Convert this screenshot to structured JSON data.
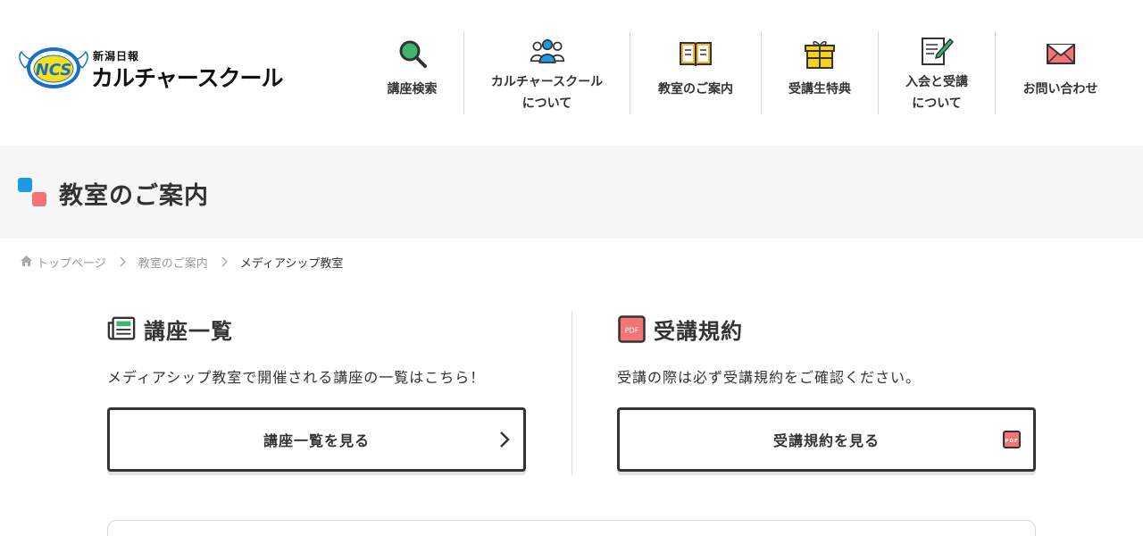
{
  "header": {
    "logo": {
      "badge_text": "NCS",
      "sub": "新潟日報",
      "main": "カルチャースクール"
    },
    "nav": [
      {
        "label": "講座検索",
        "icon": "search-icon"
      },
      {
        "label": "カルチャースクール\nについて",
        "icon": "people-icon"
      },
      {
        "label": "教室のご案内",
        "icon": "book-icon"
      },
      {
        "label": "受講生特典",
        "icon": "gift-icon"
      },
      {
        "label": "入会と受講\nについて",
        "icon": "document-pen-icon"
      },
      {
        "label": "お問い合わせ",
        "icon": "mail-icon"
      }
    ]
  },
  "page": {
    "title": "教室のご案内"
  },
  "breadcrumb": {
    "home": "トップページ",
    "parent": "教室のご案内",
    "current": "メディアシップ教室"
  },
  "sections": {
    "courses": {
      "title": "講座一覧",
      "desc": "メディアシップ教室で開催される講座の一覧はこちら！",
      "button": "講座一覧を見る",
      "icon": "newspaper-icon"
    },
    "terms": {
      "title": "受講規約",
      "desc": "受講の際は必ず受講規約をご確認ください。",
      "button": "受講規約を見る",
      "icon": "pdf-icon",
      "icon_text": "PDF"
    }
  },
  "colors": {
    "accent_blue": "#1a9be3",
    "accent_red": "#f27474",
    "text": "#333333",
    "band_bg": "#f6f6f6"
  }
}
